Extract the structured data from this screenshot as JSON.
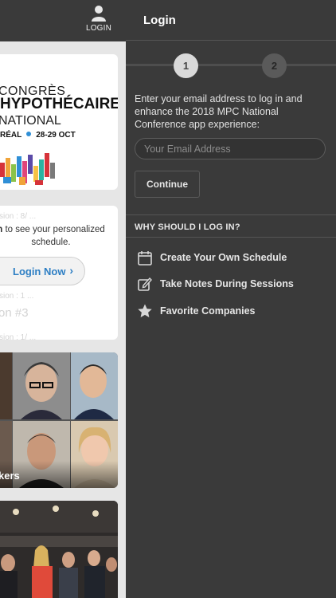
{
  "header": {
    "login_label": "LOGIN"
  },
  "banner": {
    "line1": "CONGRÈS",
    "line2": "HYPOTHÉCAIRE",
    "line3": "NATIONAL",
    "city": "RÉAL",
    "dates": "28-29 OCT"
  },
  "promo": {
    "ghost_top": "ssion : 8/ ...",
    "text_bold": "n",
    "text": " to see your personalized schedule.",
    "button_label": "Login Now",
    "ghost_mid": "ssion : 1 ...",
    "ghost_title": "on #3",
    "ghost_bottom": "ssion : 1/ ..."
  },
  "speakers": {
    "label": "kers"
  },
  "drawer": {
    "title": "Login",
    "step1": "1",
    "step2": "2",
    "intro": "Enter your email address to log in and enhance the 2018 MPC National Conference app experience:",
    "email_placeholder": "Your Email Address",
    "continue_label": "Continue",
    "why_heading": "WHY SHOULD I LOG IN?",
    "benefits": [
      {
        "label": "Create Your Own Schedule",
        "icon": "calendar-icon"
      },
      {
        "label": "Take Notes During Sessions",
        "icon": "edit-note-icon"
      },
      {
        "label": "Favorite Companies",
        "icon": "star-icon"
      }
    ]
  },
  "colors": {
    "drawer_bg": "#3a3a3a",
    "accent_blue": "#2e7fc4",
    "step_active": "#d9d9d9"
  }
}
